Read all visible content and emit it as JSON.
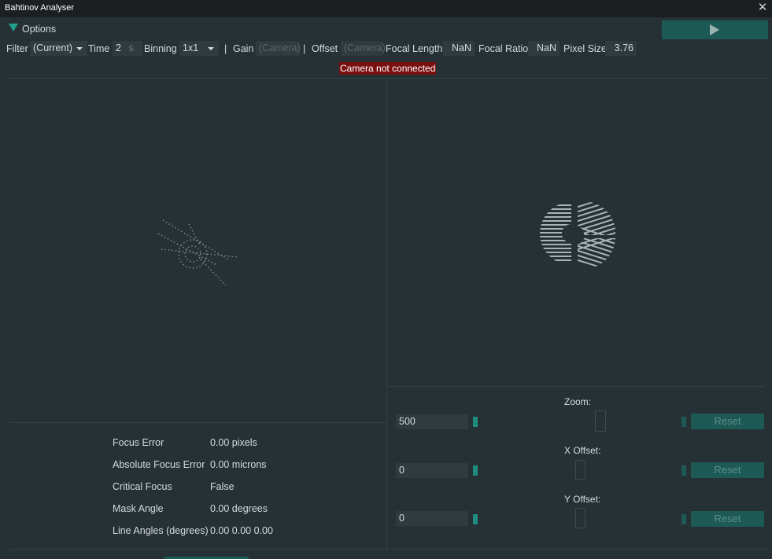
{
  "window": {
    "title": "Bahtinov Analyser",
    "close_icon": "close-icon"
  },
  "toolbar": {
    "options_label": "Options",
    "filter_label": "Filter",
    "filter_value": "(Current)",
    "time_label": "Time",
    "time_value": "2",
    "time_unit": "s",
    "binning_label": "Binning",
    "binning_value": "1x1",
    "separator": "|",
    "gain_label": "Gain",
    "gain_value": "(Camera)",
    "offset_label": "Offset",
    "offset_value": "(Camera)",
    "focal_length_label": "Focal Length",
    "focal_length_value": "NaN",
    "focal_ratio_label": "Focal Ratio",
    "focal_ratio_value": "NaN",
    "pixel_size_label": "Pixel Size",
    "pixel_size_value": "3.76",
    "run_icon": "play-icon"
  },
  "status": {
    "error_text": "Camera not connected",
    "error_color": "#7a1010"
  },
  "results": [
    {
      "label": "Focus Error",
      "value": "0.00 pixels"
    },
    {
      "label": "Absolute Focus Error",
      "value": "0.00 microns"
    },
    {
      "label": "Critical Focus",
      "value": "False"
    },
    {
      "label": "Mask Angle",
      "value": "0.00 degrees"
    },
    {
      "label": "Line Angles (degrees)",
      "value": "0.00 0.00 0.00"
    }
  ],
  "controls": {
    "zoom": {
      "label": "Zoom:",
      "value": "500",
      "reset_label": "Reset"
    },
    "x_offset": {
      "label": "X Offset:",
      "value": "0",
      "reset_label": "Reset"
    },
    "y_offset": {
      "label": "Y Offset:",
      "value": "0",
      "reset_label": "Reset"
    }
  },
  "colors": {
    "background": "#263136",
    "accent": "#1d5a55",
    "accent_bright": "#1f8c80"
  }
}
